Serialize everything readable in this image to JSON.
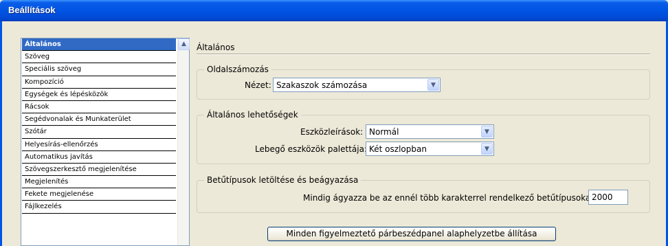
{
  "window": {
    "title": "Beállítások"
  },
  "sidebar": {
    "items": [
      {
        "label": "Általános",
        "selected": true
      },
      {
        "label": "Szöveg"
      },
      {
        "label": "Speciális szöveg"
      },
      {
        "label": "Kompozíció"
      },
      {
        "label": "Egységek és lépésközök"
      },
      {
        "label": "Rácsok"
      },
      {
        "label": "Segédvonalak és Munkaterület"
      },
      {
        "label": "Szótár"
      },
      {
        "label": "Helyesírás-ellenőrzés"
      },
      {
        "label": "Automatikus javítás"
      },
      {
        "label": "Szövegszerkesztő megjelenítése"
      },
      {
        "label": "Megjelenítés"
      },
      {
        "label": "Fekete megjelenése"
      },
      {
        "label": "Fájlkezelés"
      }
    ]
  },
  "main": {
    "title": "Általános",
    "page_numbering": {
      "legend": "Oldalszámozás",
      "view_label": "Nézet:",
      "view_value": "Szakaszok számozása"
    },
    "general_options": {
      "legend": "Általános lehetőségek",
      "tool_tips_label": "Eszközleírások:",
      "tool_tips_value": "Normál",
      "floating_palette_label": "Lebegő eszközök palettája:",
      "floating_palette_value": "Két oszlopban"
    },
    "font_download": {
      "legend": "Betűtípusok letöltése és beágyazása",
      "always_embed_label": "Mindig ágyazza be az ennél több karakterrel rendelkező betűtípusokat:",
      "always_embed_value": "2000"
    },
    "reset_button": "Minden figyelmeztető párbeszédpanel alaphelyzetbe állítása"
  },
  "icons": {
    "dropdown": "chevron-down-icon",
    "scroll_up": "scroll-up-arrow-icon"
  }
}
